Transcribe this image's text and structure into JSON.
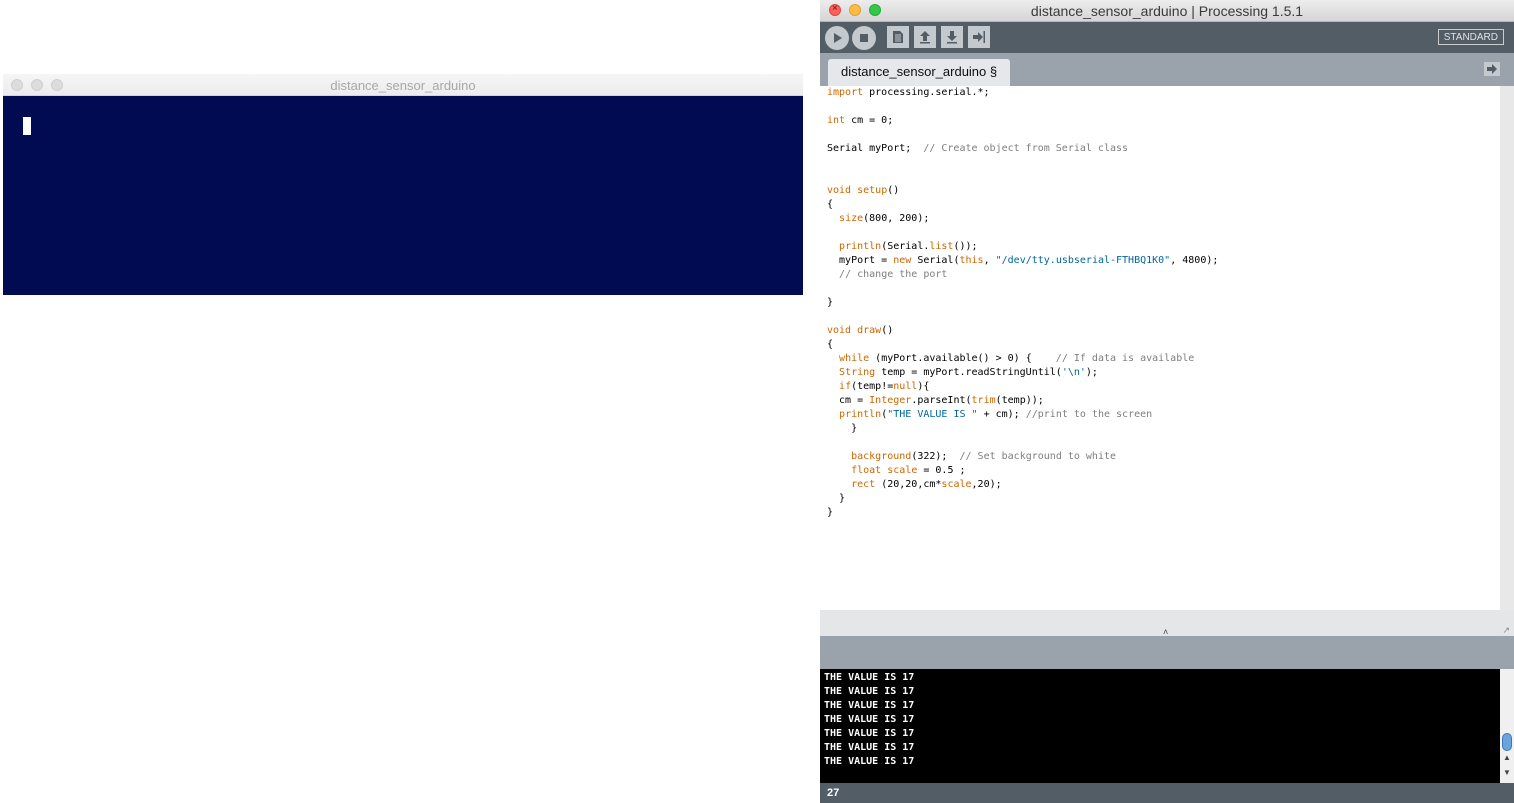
{
  "sketch_window": {
    "title": "distance_sensor_arduino",
    "canvas_background": "#000b52",
    "rect_color": "#ffffff"
  },
  "ide_window": {
    "title": "distance_sensor_arduino | Processing 1.5.1",
    "toolbar": {
      "buttons": [
        "run-icon",
        "stop-icon",
        "new-icon",
        "open-icon",
        "save-icon",
        "export-icon"
      ],
      "mode": "STANDARD"
    },
    "tab": {
      "label": "distance_sensor_arduino §"
    },
    "editor": {
      "lines": [
        "import processing.serial.*;",
        "",
        "int cm = 0;",
        "",
        "Serial myPort;  // Create object from Serial class",
        "",
        "",
        "void setup()",
        "{",
        "  size(800, 200);",
        "",
        "  println(Serial.list());",
        "  myPort = new Serial(this, \"/dev/tty.usbserial-FTHBQ1K0\", 4800);",
        "  // change the port",
        "",
        "}",
        "",
        "void draw()",
        "{",
        "  while (myPort.available() > 0) {    // If data is available",
        "  String temp = myPort.readStringUntil('\\n');",
        "  if(temp!=null){",
        "  cm = Integer.parseInt(trim(temp));",
        "  println(\"THE VALUE IS \" + cm); //print to the screen",
        "    }",
        "",
        "    background(322);  // Set background to white",
        "    float scale = 0.5 ;",
        "    rect (20,20,cm*scale,20);",
        "  }",
        "}"
      ]
    },
    "console": {
      "lines": [
        "THE VALUE IS 17",
        "THE VALUE IS 17",
        "THE VALUE IS 17",
        "THE VALUE IS 17",
        "THE VALUE IS 17",
        "THE VALUE IS 17",
        "THE VALUE IS 17"
      ]
    },
    "status": {
      "line_number": "27"
    },
    "colors": {
      "toolbar": "#525d66",
      "tab_background": "#9aa3ab",
      "keyword": "#cc6600",
      "string": "#006699",
      "comment": "#7e7e7e"
    }
  }
}
